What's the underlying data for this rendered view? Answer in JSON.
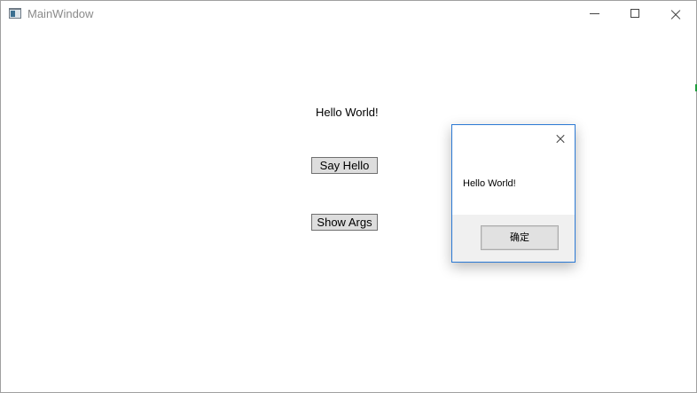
{
  "window": {
    "title": "MainWindow",
    "icon": "app-window-icon",
    "controls": [
      "minimize-icon",
      "maximize-icon",
      "close-icon"
    ]
  },
  "main": {
    "label": "Hello World!",
    "say_hello_label": "Say Hello",
    "show_args_label": "Show Args"
  },
  "dialog": {
    "message": "Hello World!",
    "ok_label": "确定",
    "close_icon": "close-icon",
    "border_color": "#2b79d4"
  }
}
